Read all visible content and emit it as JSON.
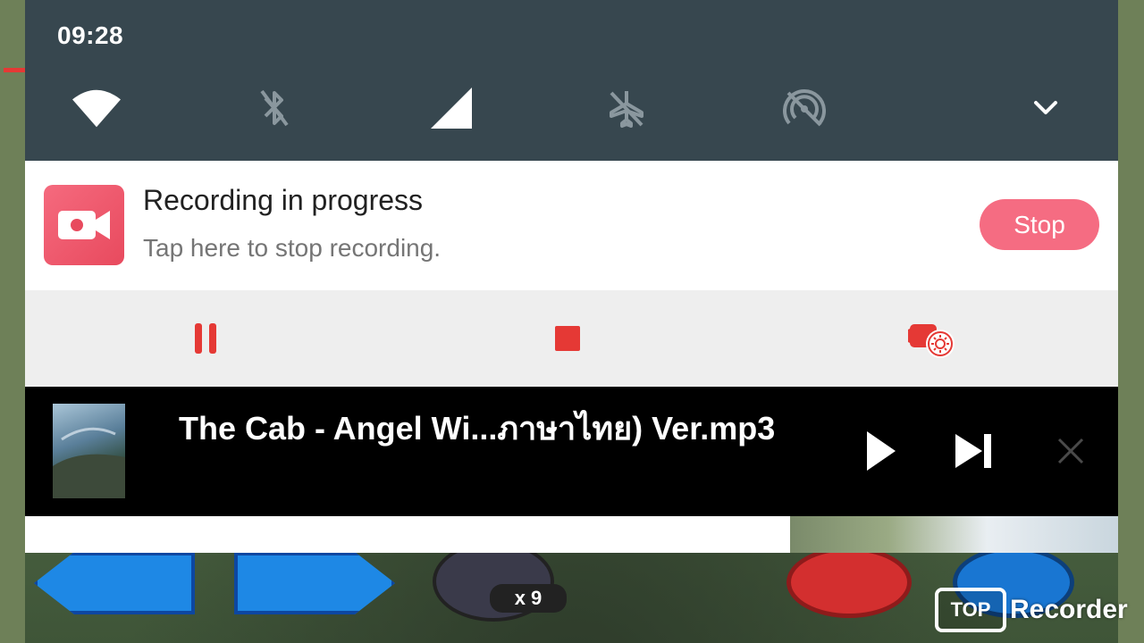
{
  "status_bar": {
    "time": "09:28"
  },
  "quick_settings": {
    "tiles": [
      {
        "icon": "wifi-icon",
        "state": "on"
      },
      {
        "icon": "bluetooth-off-icon",
        "state": "off"
      },
      {
        "icon": "cellular-signal-icon",
        "state": "on"
      },
      {
        "icon": "airplane-mode-off-icon",
        "state": "off"
      },
      {
        "icon": "hotspot-off-icon",
        "state": "off"
      }
    ],
    "expand_icon": "chevron-down-icon"
  },
  "recording_notification": {
    "title": "Recording in progress",
    "subtitle": "Tap here to stop recording.",
    "stop_label": "Stop",
    "accent_color": "#f56c82",
    "controls": [
      {
        "icon": "pause-icon"
      },
      {
        "icon": "stop-icon"
      },
      {
        "icon": "camera-settings-icon"
      }
    ],
    "control_color": "#e53935"
  },
  "media_notification": {
    "track_title": "The Cab - Angel Wi...ภาษาไทย) Ver.mp3",
    "controls": [
      {
        "icon": "play-icon"
      },
      {
        "icon": "skip-next-icon"
      },
      {
        "icon": "close-icon"
      }
    ]
  },
  "background_game": {
    "counter": "x 9"
  },
  "watermark": {
    "box_text": "TOP",
    "brand_text": "Recorder"
  }
}
